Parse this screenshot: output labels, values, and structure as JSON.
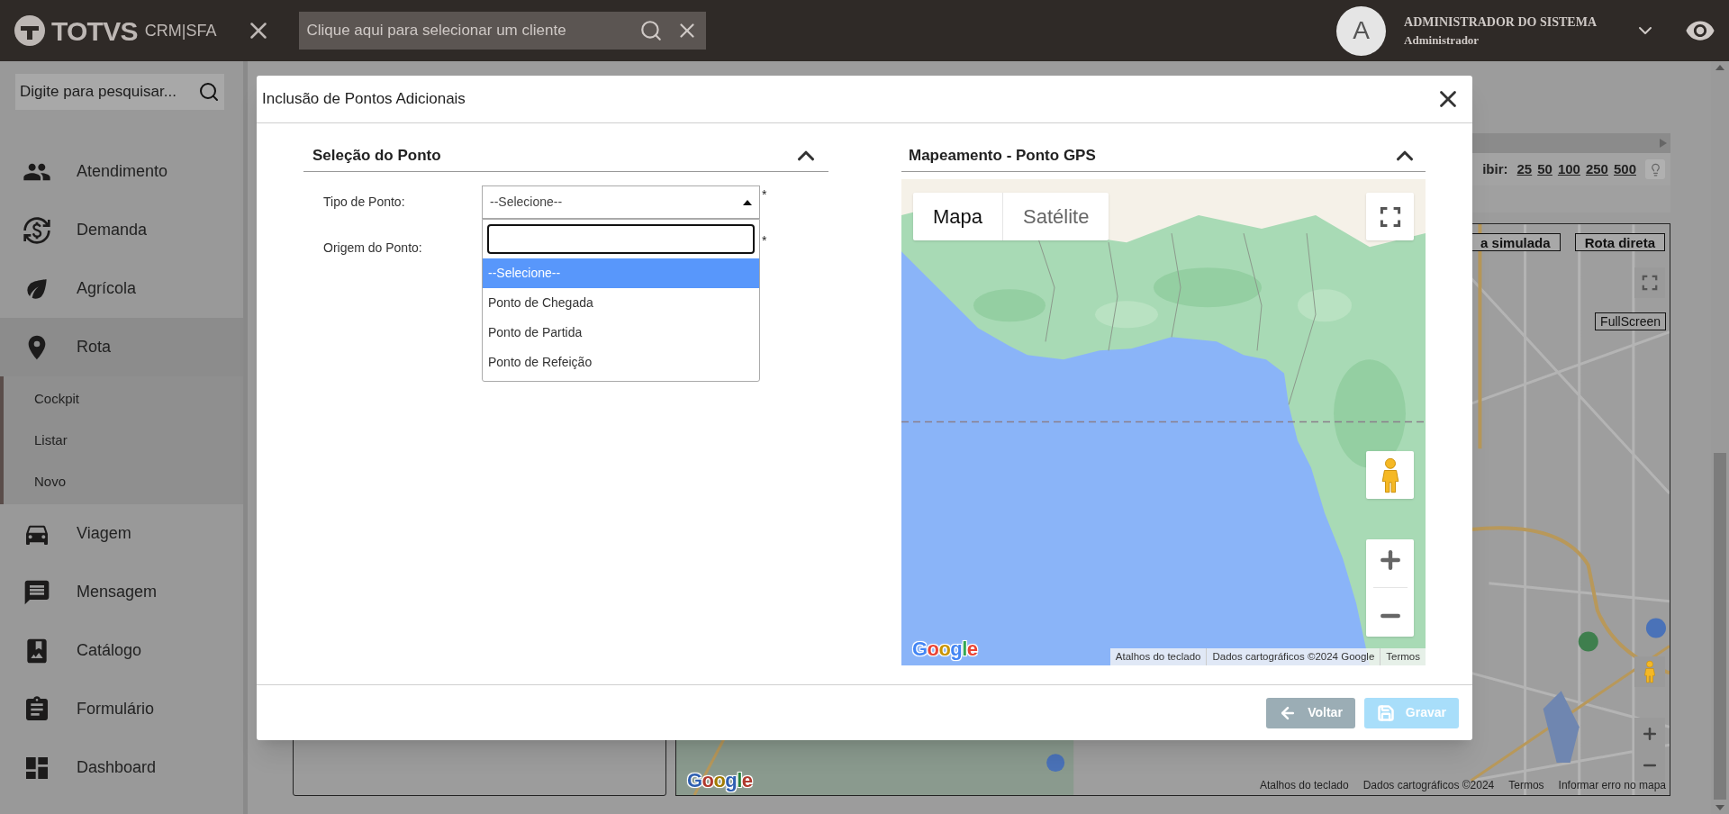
{
  "header": {
    "logo": "TOTVS",
    "product": "CRM|SFA",
    "search": {
      "placeholder": "Clique aqui para selecionar um cliente"
    },
    "user": {
      "avatar": "A",
      "name": "ADMINISTRADOR DO SISTEMA",
      "role": "Administrador"
    }
  },
  "sidebar": {
    "search": {
      "placeholder": "Digite para pesquisar..."
    },
    "items": [
      {
        "label": "Atendimento",
        "expanded": false
      },
      {
        "label": "Demanda",
        "expanded": false
      },
      {
        "label": "Agrícola",
        "expanded": false
      },
      {
        "label": "Rota",
        "expanded": true,
        "children": [
          {
            "label": "Cockpit"
          },
          {
            "label": "Listar"
          },
          {
            "label": "Novo"
          }
        ]
      },
      {
        "label": "Viagem",
        "expanded": false
      },
      {
        "label": "Mensagem",
        "expanded": false
      },
      {
        "label": "Catálogo",
        "expanded": false
      },
      {
        "label": "Formulário",
        "expanded": false
      },
      {
        "label": "Dashboard",
        "expanded": false
      }
    ]
  },
  "background": {
    "page_size": {
      "label": "ibir:",
      "options": [
        "25",
        "50",
        "100",
        "250",
        "500"
      ]
    },
    "map": {
      "buttons": [
        "a simulada",
        "Rota direta"
      ],
      "fullscreen_label": "FullScreen",
      "logo": "Google",
      "footer": [
        "Atalhos do teclado",
        "Dados cartográficos ©2024",
        "Termos",
        "Informar erro no mapa"
      ]
    }
  },
  "modal": {
    "title": "Inclusão de Pontos Adicionais",
    "form": {
      "title": "Seleção do Ponto",
      "expanded": true,
      "fields": [
        {
          "label": "Tipo de Ponto:",
          "value": "--Selecione--",
          "required_mark": "*"
        },
        {
          "label": "Origem do Ponto:",
          "required_mark": "*"
        }
      ],
      "dropdown": {
        "options": [
          {
            "label": "--Selecione--",
            "selected": true
          },
          {
            "label": "Ponto de Chegada",
            "selected": false
          },
          {
            "label": "Ponto de Partida",
            "selected": false
          },
          {
            "label": "Ponto de Refeição",
            "selected": false
          }
        ]
      }
    },
    "map_section": {
      "title": "Mapeamento - Ponto GPS",
      "expanded": true,
      "map_types": [
        {
          "label": "Mapa",
          "selected": true
        },
        {
          "label": "Satélite",
          "selected": false
        }
      ],
      "logo": "Google",
      "footer": [
        "Atalhos do teclado",
        "Dados cartográficos ©2024 Google",
        "Termos"
      ]
    },
    "buttons": [
      {
        "kind": "back",
        "label": "Voltar",
        "disabled": false
      },
      {
        "kind": "save",
        "label": "Gravar",
        "disabled": true
      }
    ]
  }
}
